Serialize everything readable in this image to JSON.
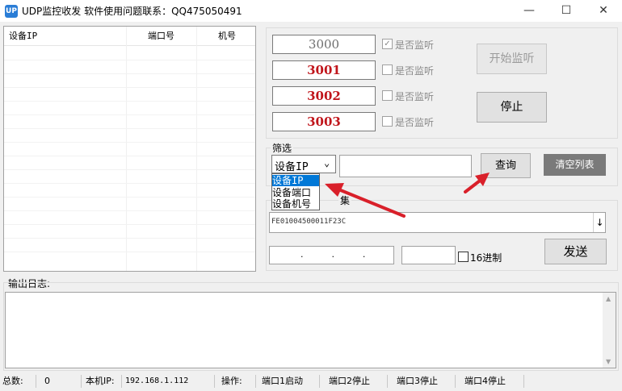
{
  "window": {
    "icon_text": "UP",
    "title": "UDP监控收发  软件使用问题联系：QQ475050491",
    "minimize_glyph": "—",
    "maximize_glyph": "☐",
    "close_glyph": "✕"
  },
  "device_list": {
    "columns": [
      "设备IP",
      "端口号",
      "机号"
    ]
  },
  "ports": [
    {
      "value": "3000",
      "checked": true,
      "label": "是否监听"
    },
    {
      "value": "3001",
      "checked": false,
      "label": "是否监听"
    },
    {
      "value": "3002",
      "checked": false,
      "label": "是否监听"
    },
    {
      "value": "3003",
      "checked": false,
      "label": "是否监听"
    }
  ],
  "buttons": {
    "start": "开始监听",
    "stop": "停止",
    "query": "查询",
    "clear": "清空列表",
    "send": "发送"
  },
  "filter": {
    "label": "筛选",
    "selected": "设备IP",
    "options": [
      "设备IP",
      "设备端口",
      "设备机号"
    ],
    "query_value": ""
  },
  "send_group": {
    "label_partial": "集",
    "data_value": "FE01004500011F23C",
    "ip_dots": ".          .          .",
    "hex_label": "16进制"
  },
  "log": {
    "label": "输出日志:"
  },
  "status": {
    "total_label": "总数:",
    "total_value": "0",
    "local_ip_label": "本机IP:",
    "local_ip_value": "192.168.1.112",
    "op_label": "操作:",
    "port1": "端口1启动",
    "port2": "端口2停止",
    "port3": "端口3停止",
    "port4": "端口4停止"
  },
  "colors": {
    "selection": "#0078d7",
    "port_active": "#c0151b",
    "arrow": "#d9202a"
  }
}
